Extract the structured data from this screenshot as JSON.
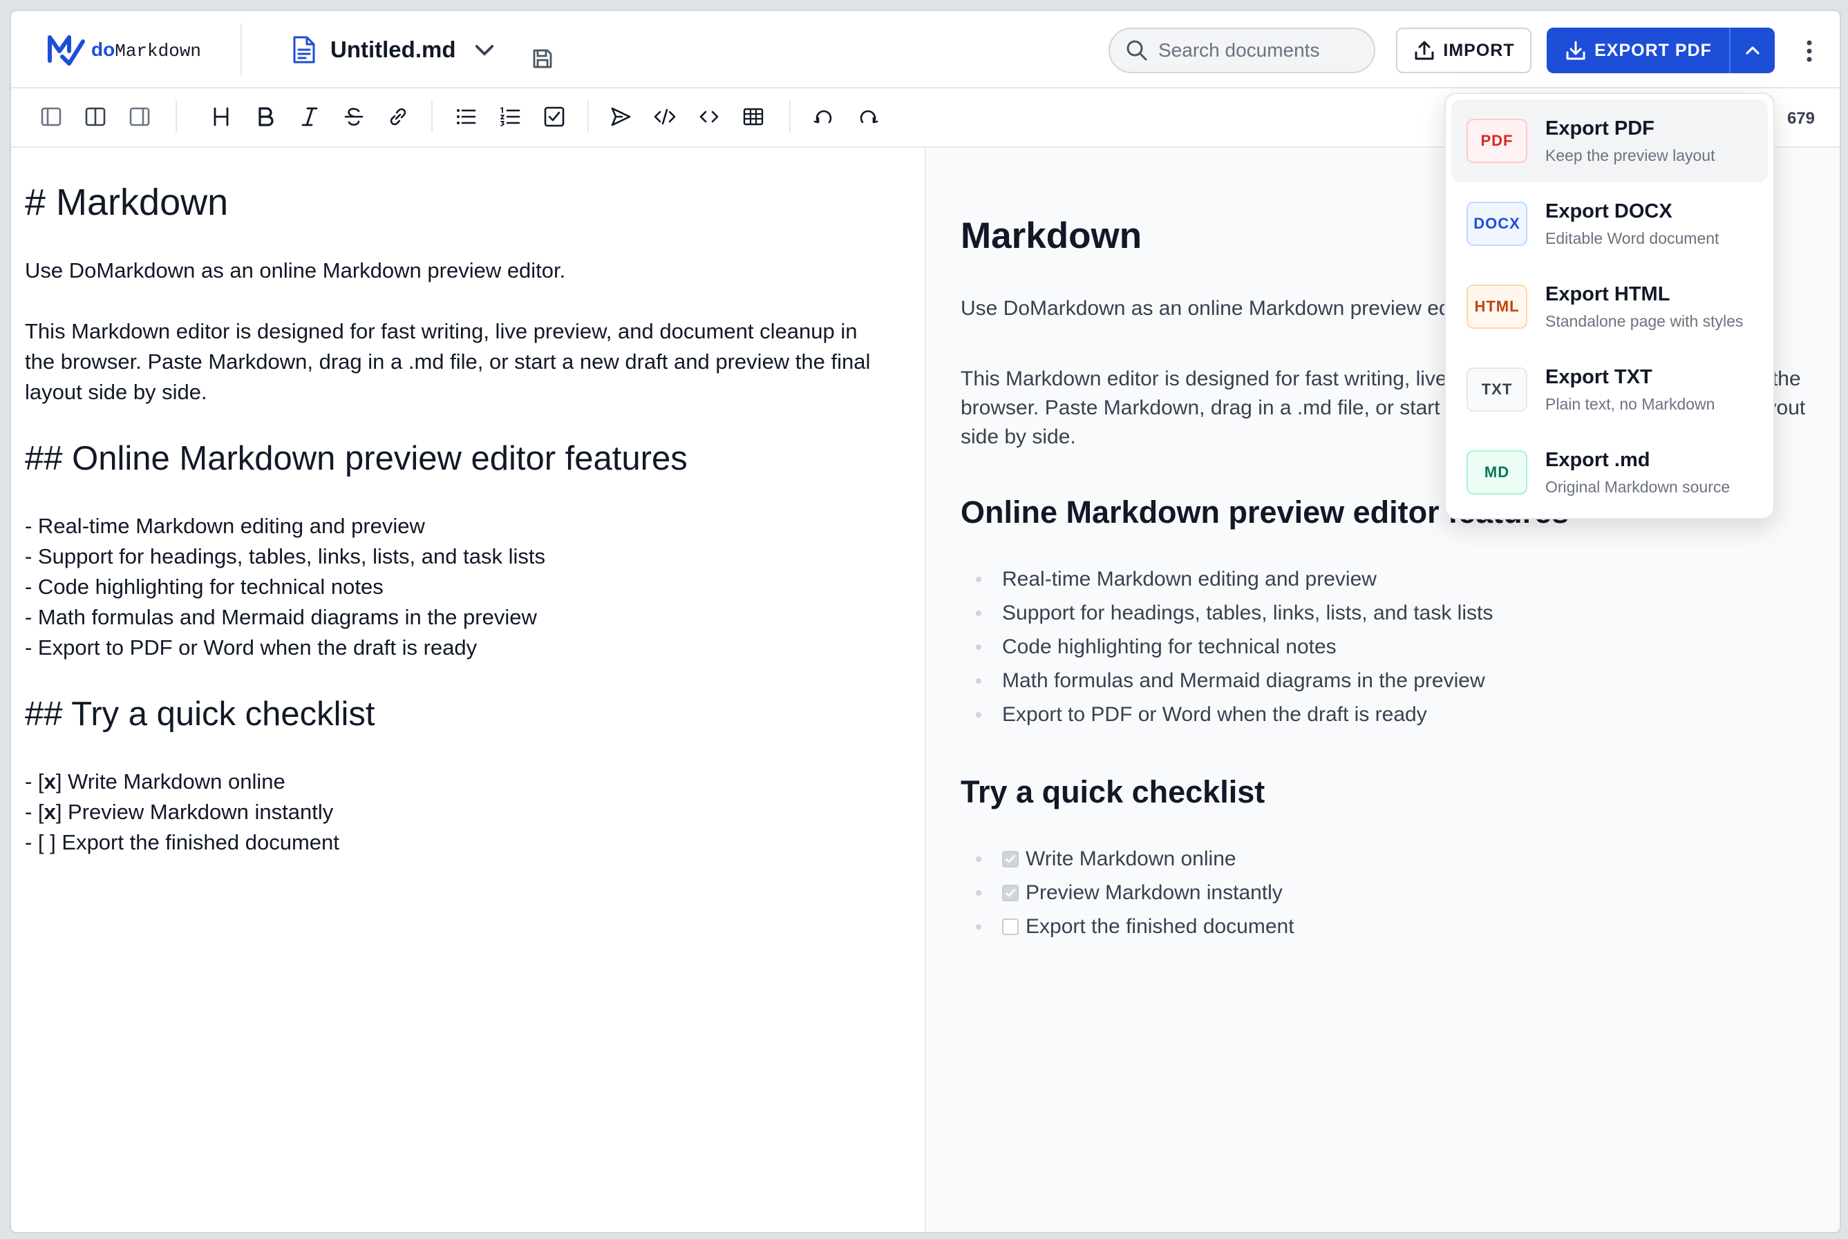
{
  "brand": {
    "do": "do",
    "rest": "Markdown"
  },
  "document": {
    "title": "Untitled.md"
  },
  "search": {
    "placeholder": "Search documents"
  },
  "toolbar": {
    "import_label": "IMPORT",
    "export_label": "EXPORT PDF",
    "word_count": "679"
  },
  "export_menu": [
    {
      "badge": "PDF",
      "title": "Export PDF",
      "subtitle": "Keep the preview layout",
      "color": "#dc2626",
      "bg": "#fef2f2",
      "border": "#fecaca"
    },
    {
      "badge": "DOCX",
      "title": "Export DOCX",
      "subtitle": "Editable Word document",
      "color": "#1d4ed8",
      "bg": "#eff6ff",
      "border": "#bfdbfe"
    },
    {
      "badge": "HTML",
      "title": "Export HTML",
      "subtitle": "Standalone page with styles",
      "color": "#c2410c",
      "bg": "#fff7ed",
      "border": "#fed7aa"
    },
    {
      "badge": "TXT",
      "title": "Export TXT",
      "subtitle": "Plain text, no Markdown",
      "color": "#374151",
      "bg": "#f9fafb",
      "border": "#e5e7eb"
    },
    {
      "badge": "MD",
      "title": "Export .md",
      "subtitle": "Original Markdown source",
      "color": "#047857",
      "bg": "#ecfdf5",
      "border": "#a7f3d0"
    }
  ],
  "editor": {
    "h1": "# Markdown",
    "intro": "Use DoMarkdown as an online Markdown preview editor.",
    "para_lines": [
      "This Markdown editor is designed for fast writing, live preview, and document cleanup in",
      "the browser. Paste Markdown, drag in a .md file, or start a new draft and preview the final",
      "layout side by side."
    ],
    "h2_features": "## Online Markdown preview editor features",
    "features": [
      "- Real-time Markdown editing and preview",
      "- Support for headings, tables, links, lists, and task lists",
      "- Code highlighting for technical notes",
      "- Math formulas and Mermaid diagrams in the preview",
      "- Export to PDF or Word when the draft is ready"
    ],
    "h2_checklist": "## Try a quick checklist",
    "checklist": [
      {
        "prefix": "- [",
        "mark": "x",
        "suffix": "] Write Markdown online"
      },
      {
        "prefix": "- [",
        "mark": "x",
        "suffix": "] Preview Markdown instantly"
      },
      {
        "prefix": "- [ ] Export the finished document",
        "mark": "",
        "suffix": ""
      }
    ]
  },
  "preview": {
    "h1": "Markdown",
    "intro": "Use DoMarkdown as an online Markdown preview editor.",
    "para": "This Markdown editor is designed for fast writing, live preview, and document cleanup in the browser. Paste Markdown, drag in a .md file, or start a new draft and preview the final layout side by side.",
    "h2_features": "Online Markdown preview editor features",
    "features": [
      "Real-time Markdown editing and preview",
      "Support for headings, tables, links, lists, and task lists",
      "Code highlighting for technical notes",
      "Math formulas and Mermaid diagrams in the preview",
      "Export to PDF or Word when the draft is ready"
    ],
    "h2_checklist": "Try a quick checklist",
    "checklist": [
      {
        "text": "Write Markdown online",
        "checked": true
      },
      {
        "text": "Preview Markdown instantly",
        "checked": true
      },
      {
        "text": "Export the finished document",
        "checked": false
      }
    ]
  },
  "colors": {
    "accent": "#1d4ed8",
    "accent_split": "#3b82f6"
  }
}
